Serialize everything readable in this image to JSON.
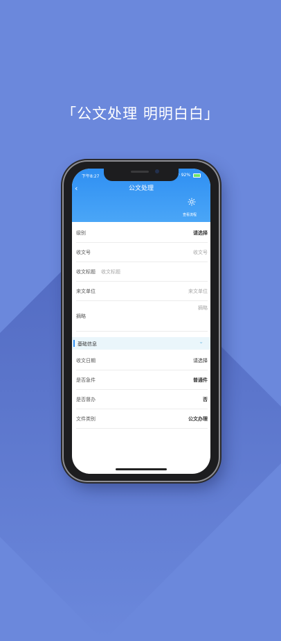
{
  "headline": "「公文处理  明明白白」",
  "status": {
    "time": "下午8:27",
    "battery": "92%"
  },
  "nav": {
    "title": "公文处理",
    "back_icon": "chevron-left-icon",
    "flow_label": "查看流程",
    "flow_icon": "gear-icon"
  },
  "form": {
    "rows": [
      {
        "label": "级别",
        "value": "请选择"
      },
      {
        "label": "收文号",
        "placeholder": "收文号"
      },
      {
        "label": "收文标题",
        "placeholder": "收文标题"
      },
      {
        "label": "来文单位",
        "placeholder": "来文单位"
      },
      {
        "label": "摘略",
        "placeholder": "摘略"
      }
    ]
  },
  "section": {
    "title": "基础信息"
  },
  "basic": {
    "rows": [
      {
        "label": "收文日期",
        "value": "请选择"
      },
      {
        "label": "是否急件",
        "value": "普通件"
      },
      {
        "label": "是否督办",
        "value": "否"
      },
      {
        "label": "文件类别",
        "value": "公文办理"
      }
    ]
  },
  "colors": {
    "background": "#6b88dc",
    "accent": "#2f8ff2"
  }
}
